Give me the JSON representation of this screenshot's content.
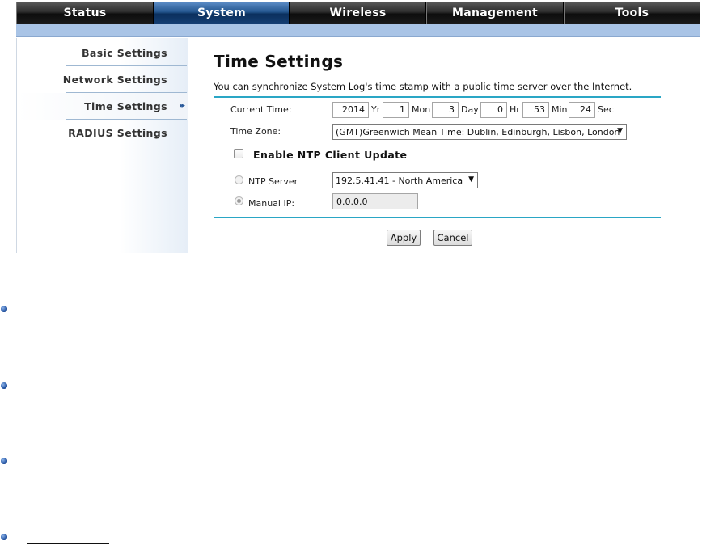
{
  "nav": {
    "tabs": [
      {
        "label": "Status",
        "active": false
      },
      {
        "label": "System",
        "active": true
      },
      {
        "label": "Wireless",
        "active": false
      },
      {
        "label": "Management",
        "active": false
      },
      {
        "label": "Tools",
        "active": false
      }
    ]
  },
  "sidebar": {
    "items": [
      {
        "label": "Basic Settings"
      },
      {
        "label": "Network Settings"
      },
      {
        "label": "Time Settings",
        "selected": true
      },
      {
        "label": "RADIUS Settings"
      }
    ]
  },
  "main": {
    "title": "Time Settings",
    "description": "You can synchronize System Log's time stamp with a public time server over the Internet.",
    "current_time": {
      "label": "Current Time:",
      "year": "2014",
      "year_unit": "Yr",
      "month": "1",
      "month_unit": "Mon",
      "day": "3",
      "day_unit": "Day",
      "hour": "0",
      "hour_unit": "Hr",
      "minute": "53",
      "minute_unit": "Min",
      "second": "24",
      "second_unit": "Sec"
    },
    "time_zone": {
      "label": "Time Zone:",
      "selected": "(GMT)Greenwich Mean Time: Dublin, Edinburgh, Lisbon, London"
    },
    "ntp": {
      "enable_label": "Enable NTP Client Update",
      "enabled": false,
      "server_label": "NTP Server",
      "server_selected": "192.5.41.41 - North America",
      "manual_label": "Manual IP:",
      "manual_value": "0.0.0.0"
    },
    "buttons": {
      "apply": "Apply",
      "cancel": "Cancel"
    }
  },
  "colors": {
    "accent_line": "#2aa6c5",
    "nav_active": "#24568f",
    "subbar": "#a9c4e6"
  }
}
